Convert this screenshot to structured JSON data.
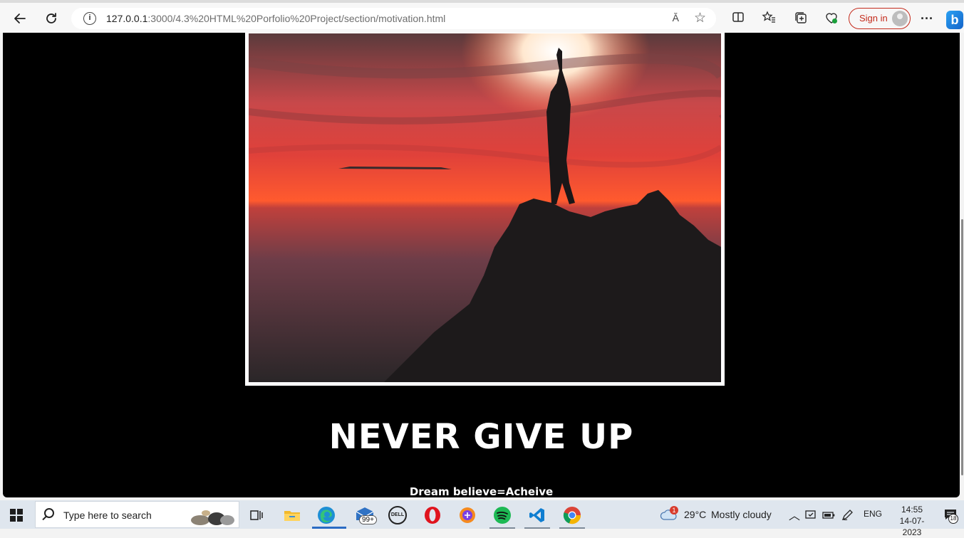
{
  "browser": {
    "url_host": "127.0.0.1",
    "url_rest": ":3000/4.3%20HTML%20Porfolio%20Project/section/motivation.html",
    "read_aloud": "Ă",
    "sign_in_label": "Sign in",
    "bing_label": "b"
  },
  "page": {
    "heading": "NEVER GIVE UP",
    "subheading": "Dream believe=Acheive"
  },
  "taskbar": {
    "search_placeholder": "Type here to search",
    "mail_badge": "99+",
    "dell_label": "DELL",
    "weather_badge": "1",
    "temperature": "29°C",
    "weather": "Mostly cloudy",
    "language": "ENG",
    "time": "14:55",
    "date": "14-07-2023",
    "notification_count": "18"
  },
  "colors": {
    "page_background": "#000000",
    "heading_color": "#ffffff",
    "signin_accent": "#c42b1c"
  }
}
